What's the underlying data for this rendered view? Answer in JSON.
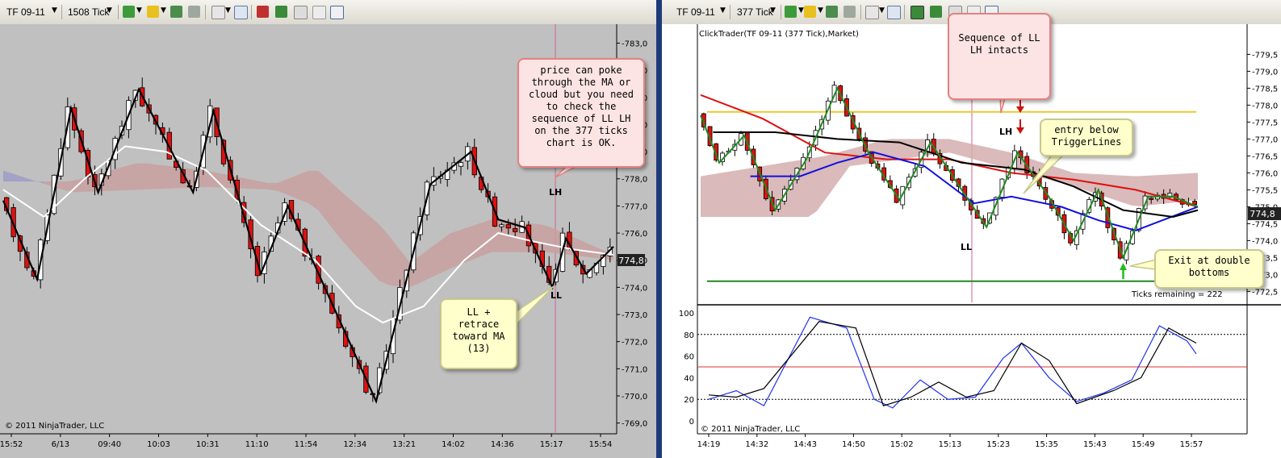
{
  "left": {
    "toolbar": {
      "instrument": "TF 09-11",
      "interval": "1508 Tick"
    },
    "copyright": "© 2011 NinjaTrader, LLC",
    "price_badge": "774,8",
    "annotations": {
      "ll_lh_sequence": [
        "price can poke",
        "through the MA or",
        "cloud but you need",
        "to check the",
        "sequence of LL LH",
        "on the 377 ticks",
        "chart is OK."
      ],
      "retrace": [
        "LL +",
        "retrace",
        "toward MA",
        "(13)"
      ],
      "lh_label": "LH",
      "ll_label": "LL"
    }
  },
  "right": {
    "toolbar": {
      "instrument": "TF 09-11",
      "interval": "377 Tick"
    },
    "chart_title": "ClickTrader(TF 09-11 (377 Tick),Market)",
    "copyright": "© 2011 NinjaTrader, LLC",
    "price_badge": "774,8",
    "ticks_remaining": "Ticks remaining = 222",
    "annotations": {
      "sequence": [
        "Sequence of LL",
        "LH intacts"
      ],
      "entry": [
        "entry below",
        "TriggerLines"
      ],
      "exit": [
        "Exit at double",
        "bottoms"
      ],
      "lh_label": "LH",
      "ll_label": "LL"
    }
  },
  "colors": {
    "bull": "#ffffff",
    "bear": "#dd1111",
    "zigzag_left": "#000000",
    "zigzag_right": "#228822",
    "ma_white": "#ffffff",
    "cloud_up": "#9c9cc8",
    "cloud_down": "#c8a0a0"
  },
  "chart_data": [
    {
      "type": "candlestick",
      "title": "",
      "interval": "1508 Tick",
      "ylim": [
        768.9,
        783.4
      ],
      "y_ticks": [
        "783,0",
        "782,0",
        "781,0",
        "780,0",
        "779,0",
        "778,0",
        "777,0",
        "776,0",
        "775,0",
        "774,0",
        "773,0",
        "772,0",
        "771,0",
        "770,0",
        "769,0"
      ],
      "x_ticks": [
        "15:52",
        "6/13",
        "09:40",
        "10:03",
        "10:31",
        "11:10",
        "11:54",
        "12:34",
        "13:21",
        "14:02",
        "14:36",
        "15:17",
        "15:54"
      ],
      "last_price": 774.8,
      "zigzag": [
        [
          0,
          777.2
        ],
        [
          5,
          774.3
        ],
        [
          10,
          780.6
        ],
        [
          14,
          777.5
        ],
        [
          20,
          781.3
        ],
        [
          28,
          777.5
        ],
        [
          31,
          780.5
        ],
        [
          38,
          774.5
        ],
        [
          42,
          777.0
        ],
        [
          55,
          769.8
        ],
        [
          63,
          777.8
        ],
        [
          69,
          779.0
        ],
        [
          73,
          776.5
        ],
        [
          77,
          776.2
        ],
        [
          81,
          774.0
        ],
        [
          83,
          775.8
        ],
        [
          86,
          774.5
        ],
        [
          90,
          775.5
        ]
      ],
      "ma_white": [
        [
          0,
          777.6
        ],
        [
          6,
          776.6
        ],
        [
          12,
          778.0
        ],
        [
          18,
          779.2
        ],
        [
          24,
          779.0
        ],
        [
          30,
          778.3
        ],
        [
          38,
          776.3
        ],
        [
          46,
          775.0
        ],
        [
          52,
          773.3
        ],
        [
          56,
          772.7
        ],
        [
          62,
          773.3
        ],
        [
          68,
          775.0
        ],
        [
          73,
          776.0
        ],
        [
          78,
          775.7
        ],
        [
          84,
          775.4
        ],
        [
          90,
          775.2
        ]
      ],
      "cloud_upper": [
        [
          0,
          777.9
        ],
        [
          10,
          777.9
        ],
        [
          20,
          778.6
        ],
        [
          30,
          778.3
        ],
        [
          40,
          777.8
        ],
        [
          46,
          778.4
        ],
        [
          50,
          777.5
        ],
        [
          56,
          776.2
        ],
        [
          60,
          774.9
        ],
        [
          66,
          776.0
        ],
        [
          72,
          776.5
        ],
        [
          80,
          776.3
        ],
        [
          90,
          775.2
        ]
      ],
      "cloud_lower": [
        [
          0,
          778.3
        ],
        [
          10,
          777.5
        ],
        [
          20,
          777.6
        ],
        [
          30,
          777.7
        ],
        [
          40,
          777.6
        ],
        [
          46,
          777.0
        ],
        [
          50,
          775.7
        ],
        [
          56,
          774.1
        ],
        [
          60,
          774.0
        ],
        [
          66,
          774.7
        ],
        [
          72,
          775.3
        ],
        [
          80,
          775.3
        ],
        [
          90,
          775.0
        ]
      ]
    },
    {
      "type": "candlestick",
      "title": "ClickTrader(TF 09-11 (377 Tick),Market)",
      "interval": "377 Tick",
      "ylim": [
        772.2,
        780.2
      ],
      "y_ticks": [
        "779,5",
        "779,0",
        "778,5",
        "778,0",
        "777,5",
        "777,0",
        "776,5",
        "776,0",
        "775,5",
        "775,0",
        "774,5",
        "774,0",
        "773,5",
        "773,0",
        "772,5"
      ],
      "x_ticks": [
        "14:19",
        "14:32",
        "14:43",
        "14:50",
        "15:02",
        "15:13",
        "15:23",
        "15:35",
        "15:43",
        "15:49",
        "15:57"
      ],
      "last_price": 774.8,
      "yellow_line": 777.8,
      "green_line": 772.8,
      "zigzag": [
        [
          0,
          777.7
        ],
        [
          3,
          776.3
        ],
        [
          7,
          777.1
        ],
        [
          12,
          774.9
        ],
        [
          17,
          776.4
        ],
        [
          22,
          778.5
        ],
        [
          27,
          776.6
        ],
        [
          32,
          775.2
        ],
        [
          37,
          776.9
        ],
        [
          42,
          775.5
        ],
        [
          46,
          774.4
        ],
        [
          51,
          776.6
        ],
        [
          56,
          775.3
        ],
        [
          60,
          774.0
        ],
        [
          64,
          775.5
        ],
        [
          68,
          773.5
        ],
        [
          72,
          775.3
        ],
        [
          76,
          775.3
        ],
        [
          80,
          775.0
        ]
      ],
      "red_ma": [
        [
          0,
          778.3
        ],
        [
          10,
          777.6
        ],
        [
          20,
          776.6
        ],
        [
          30,
          776.4
        ],
        [
          40,
          776.4
        ],
        [
          50,
          776.0
        ],
        [
          60,
          775.8
        ],
        [
          70,
          775.5
        ],
        [
          80,
          775.0
        ]
      ],
      "blue_ma": [
        [
          8,
          775.9
        ],
        [
          16,
          775.9
        ],
        [
          22,
          776.3
        ],
        [
          28,
          776.6
        ],
        [
          36,
          776.2
        ],
        [
          44,
          775.1
        ],
        [
          50,
          775.3
        ],
        [
          58,
          775.0
        ],
        [
          64,
          774.6
        ],
        [
          70,
          774.3
        ],
        [
          80,
          775.0
        ]
      ],
      "black_ma": [
        [
          2,
          777.2
        ],
        [
          12,
          777.2
        ],
        [
          22,
          777.0
        ],
        [
          32,
          776.9
        ],
        [
          42,
          776.3
        ],
        [
          52,
          776.1
        ],
        [
          60,
          775.6
        ],
        [
          68,
          774.9
        ],
        [
          76,
          774.7
        ],
        [
          80,
          774.9
        ]
      ],
      "cloud_upper": [
        [
          0,
          775.9
        ],
        [
          20,
          776.5
        ],
        [
          30,
          777.0
        ],
        [
          40,
          777.0
        ],
        [
          50,
          776.6
        ],
        [
          60,
          776.0
        ],
        [
          70,
          775.9
        ],
        [
          80,
          776.0
        ]
      ],
      "cloud_lower": [
        [
          0,
          774.7
        ],
        [
          18,
          774.7
        ],
        [
          24,
          776.2
        ],
        [
          40,
          776.6
        ],
        [
          50,
          776.1
        ],
        [
          60,
          775.6
        ],
        [
          70,
          775.0
        ],
        [
          80,
          775.2
        ]
      ],
      "oscillator": {
        "ylim": [
          0,
          100
        ],
        "y_ticks": [
          "100",
          "80",
          "60",
          "40",
          "20",
          "0"
        ],
        "levels": [
          80,
          50,
          20
        ],
        "blue": [
          [
            0,
            20
          ],
          [
            6,
            28
          ],
          [
            12,
            14
          ],
          [
            22,
            96
          ],
          [
            30,
            86
          ],
          [
            36,
            20
          ],
          [
            40,
            12
          ],
          [
            46,
            38
          ],
          [
            52,
            20
          ],
          [
            58,
            22
          ],
          [
            64,
            58
          ],
          [
            68,
            72
          ],
          [
            74,
            40
          ],
          [
            80,
            18
          ],
          [
            86,
            26
          ],
          [
            92,
            38
          ],
          [
            98,
            88
          ],
          [
            104,
            74
          ],
          [
            106,
            62
          ]
        ],
        "black": [
          [
            0,
            24
          ],
          [
            6,
            22
          ],
          [
            12,
            30
          ],
          [
            24,
            92
          ],
          [
            32,
            86
          ],
          [
            38,
            14
          ],
          [
            44,
            22
          ],
          [
            50,
            36
          ],
          [
            56,
            22
          ],
          [
            62,
            28
          ],
          [
            68,
            72
          ],
          [
            74,
            56
          ],
          [
            80,
            16
          ],
          [
            88,
            28
          ],
          [
            94,
            40
          ],
          [
            100,
            86
          ],
          [
            106,
            72
          ]
        ]
      }
    }
  ]
}
